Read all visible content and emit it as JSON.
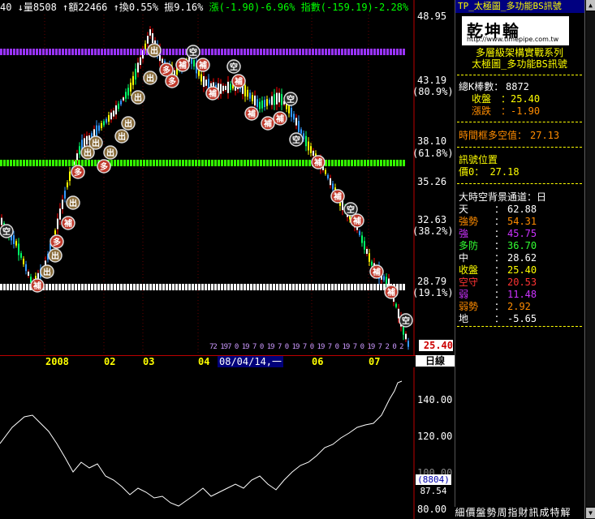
{
  "topbar": {
    "close": "40",
    "volume": "↓量8508",
    "amount": "↑額22466",
    "turnover": "↑換0.55%",
    "amplitude": "振9.16%",
    "change": "漲(-1.90)-6.96%",
    "index": "指數(-159.19)-2.28%"
  },
  "price_axis": {
    "labels": [
      "48.95",
      "43.19",
      "(80.9%)",
      "38.10",
      "(61.8%)",
      "35.26",
      "32.63",
      "(38.2%)",
      "28.79",
      "(19.1%)"
    ],
    "last_price": "25.40"
  },
  "time_axis": {
    "labels": [
      "2008",
      "02",
      "03",
      "04",
      "06",
      "07"
    ],
    "selected": "08/04/14,一",
    "period": "日線",
    "marker_row": "72 197 0 19 7 0 19 7 0 19 7 0 19 7 0 19 7 0 19 7 2 0 2"
  },
  "sub_axis": {
    "labels": [
      "140.00",
      "120.00",
      "100.00",
      "80.00"
    ],
    "box1": "(8804)",
    "box2": "87.54"
  },
  "panel": {
    "title": "TP_太極圖_多功能BS訊號",
    "logo_text": "乾坤輪",
    "logo_url": "http://www.timepipe.com.tw",
    "subtitle1": "多層級架構實戰系列",
    "subtitle2": "太極圖_多功能BS訊號",
    "total_k_label": "總K棒數：",
    "total_k_value": "8872",
    "close_label": "收盤",
    "close_value": "：25.40",
    "change_label": "漲跌",
    "change_value": "：-1.90",
    "bull_bear_label": "時間框多空值：",
    "bull_bear_value": "27.13",
    "signal_label": "訊號位置",
    "signal_value": "價0： 27.18",
    "channel_title": "大時空背景通道：日",
    "rows": [
      {
        "label": "天",
        "value": "62.88",
        "color": "#ffffff"
      },
      {
        "label": "強勢",
        "value": "54.31",
        "color": "#ff8c00"
      },
      {
        "label": "強",
        "value": "45.75",
        "color": "#cc33ff"
      },
      {
        "label": "多防",
        "value": "36.70",
        "color": "#33ff33"
      },
      {
        "label": "中",
        "value": "28.62",
        "color": "#ffffff"
      },
      {
        "label": "收盤",
        "value": "25.40",
        "color": "#ffff00"
      },
      {
        "label": "空守",
        "value": "20.53",
        "color": "#ff3333"
      },
      {
        "label": "弱",
        "value": "11.48",
        "color": "#cc33ff"
      },
      {
        "label": "弱勢",
        "value": "2.92",
        "color": "#ff8c00"
      },
      {
        "label": "地",
        "value": "-5.65",
        "color": "#ffffff"
      }
    ],
    "tabs": [
      "細",
      "價",
      "盤",
      "勢",
      "周",
      "指",
      "財",
      "訊",
      "成",
      "特",
      "解"
    ]
  },
  "colors": {
    "up": "#ff0000",
    "down": "#00ffff",
    "line_purple": "#9933ff",
    "line_green": "#33ff00",
    "line_white": "#ffffff"
  }
}
